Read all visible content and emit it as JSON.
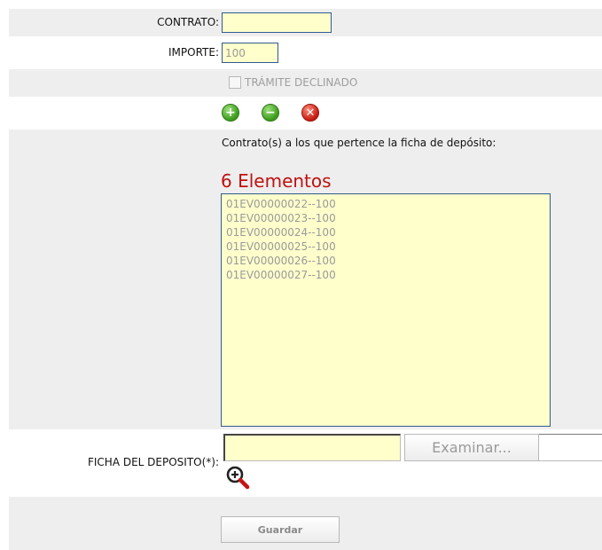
{
  "form": {
    "contrato_label": "CONTRATO:",
    "contrato_value": "",
    "importe_label": "IMPORTE:",
    "importe_value": "100",
    "tramite_label": "TRÁMITE DECLINADO",
    "actions": {
      "add": "add-icon",
      "remove": "remove-icon",
      "clear": "clear-icon"
    },
    "contracts_caption": "Contrato(s) a los que pertence la ficha de depósito:",
    "contracts_count": "6 Elementos",
    "contracts": [
      "01EV00000022--100",
      "01EV00000023--100",
      "01EV00000024--100",
      "01EV00000025--100",
      "01EV00000026--100",
      "01EV00000027--100"
    ],
    "ficha_label": "FICHA DEL DEPOSITO(*):",
    "ficha_value": "",
    "browse_label": "Examinar...",
    "zoom_icon": "zoom-in-icon",
    "save_label": "Guardar"
  },
  "colors": {
    "field_bg": "#ffffcc",
    "field_border": "#2f5b8f",
    "count_red": "#c01010",
    "row_shade": "#eeeeee"
  }
}
